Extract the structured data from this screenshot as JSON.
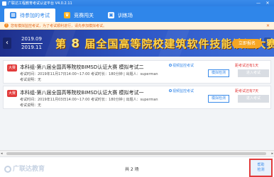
{
  "window": {
    "title": "广联达工程教育考试认证平台 V4.0.2.11",
    "minimize_glyph": "—",
    "close_glyph": "✕"
  },
  "tabs": [
    {
      "label": "待参加的考试",
      "icon": "calendar-icon",
      "active": true
    },
    {
      "label": "竞赛闯关",
      "icon": "trophy-icon",
      "active": false
    },
    {
      "label": "训练场",
      "icon": "training-icon",
      "active": false
    }
  ],
  "notice": {
    "icon": "warning-icon",
    "text": "您有模拟监控考试，为了考试顺利进行，请先参加模拟考试。",
    "close_glyph": "✕"
  },
  "banner": {
    "date_start": "2019.09",
    "date_end": "2019.11",
    "prefix": "第",
    "number": "8",
    "suffix": "届全国高等院校建筑软件技能认证大赛",
    "signup_label": "立即报名",
    "prev_glyph": "‹",
    "next_glyph": "›"
  },
  "exams": [
    {
      "badge": "大赛",
      "title": "本科组-第八届全国高等院校BIMSD认证大赛 模拟考试二",
      "status": "视频监控考试",
      "meta": "考试时间：2019年11月17日14:00~17:00     考试时长：180分钟  |  出题人：superman",
      "meta2": "考试说明：无",
      "mock_label": "模拟检测",
      "deadline": "距考试还有1天",
      "enter_label": "进入考试"
    },
    {
      "badge": "大赛",
      "title": "本科组-第八届全国高等院校BIMSD认证大赛 模拟考试一",
      "status": "视频监控考试",
      "meta": "考试时间：2019年11月03日14:00~17:00     考试时长：180分钟  |  出题人：superman",
      "meta2": "考试说明：无",
      "mock_label": "模拟检测",
      "deadline": "距考试还有7天",
      "enter_label": "进入考试"
    }
  ],
  "scroll": {
    "left_glyph": "◂",
    "right_glyph": "▸"
  },
  "footer": {
    "logo_text": "广联达教育",
    "total_text": "共 2 场",
    "help_line1": "帮助",
    "help_line2": "检测"
  },
  "colors": {
    "brand_blue": "#2f86ea",
    "badge_red": "#e23b3b",
    "notice_orange": "#e46a1e",
    "banner_gold": "#ffd54a"
  }
}
